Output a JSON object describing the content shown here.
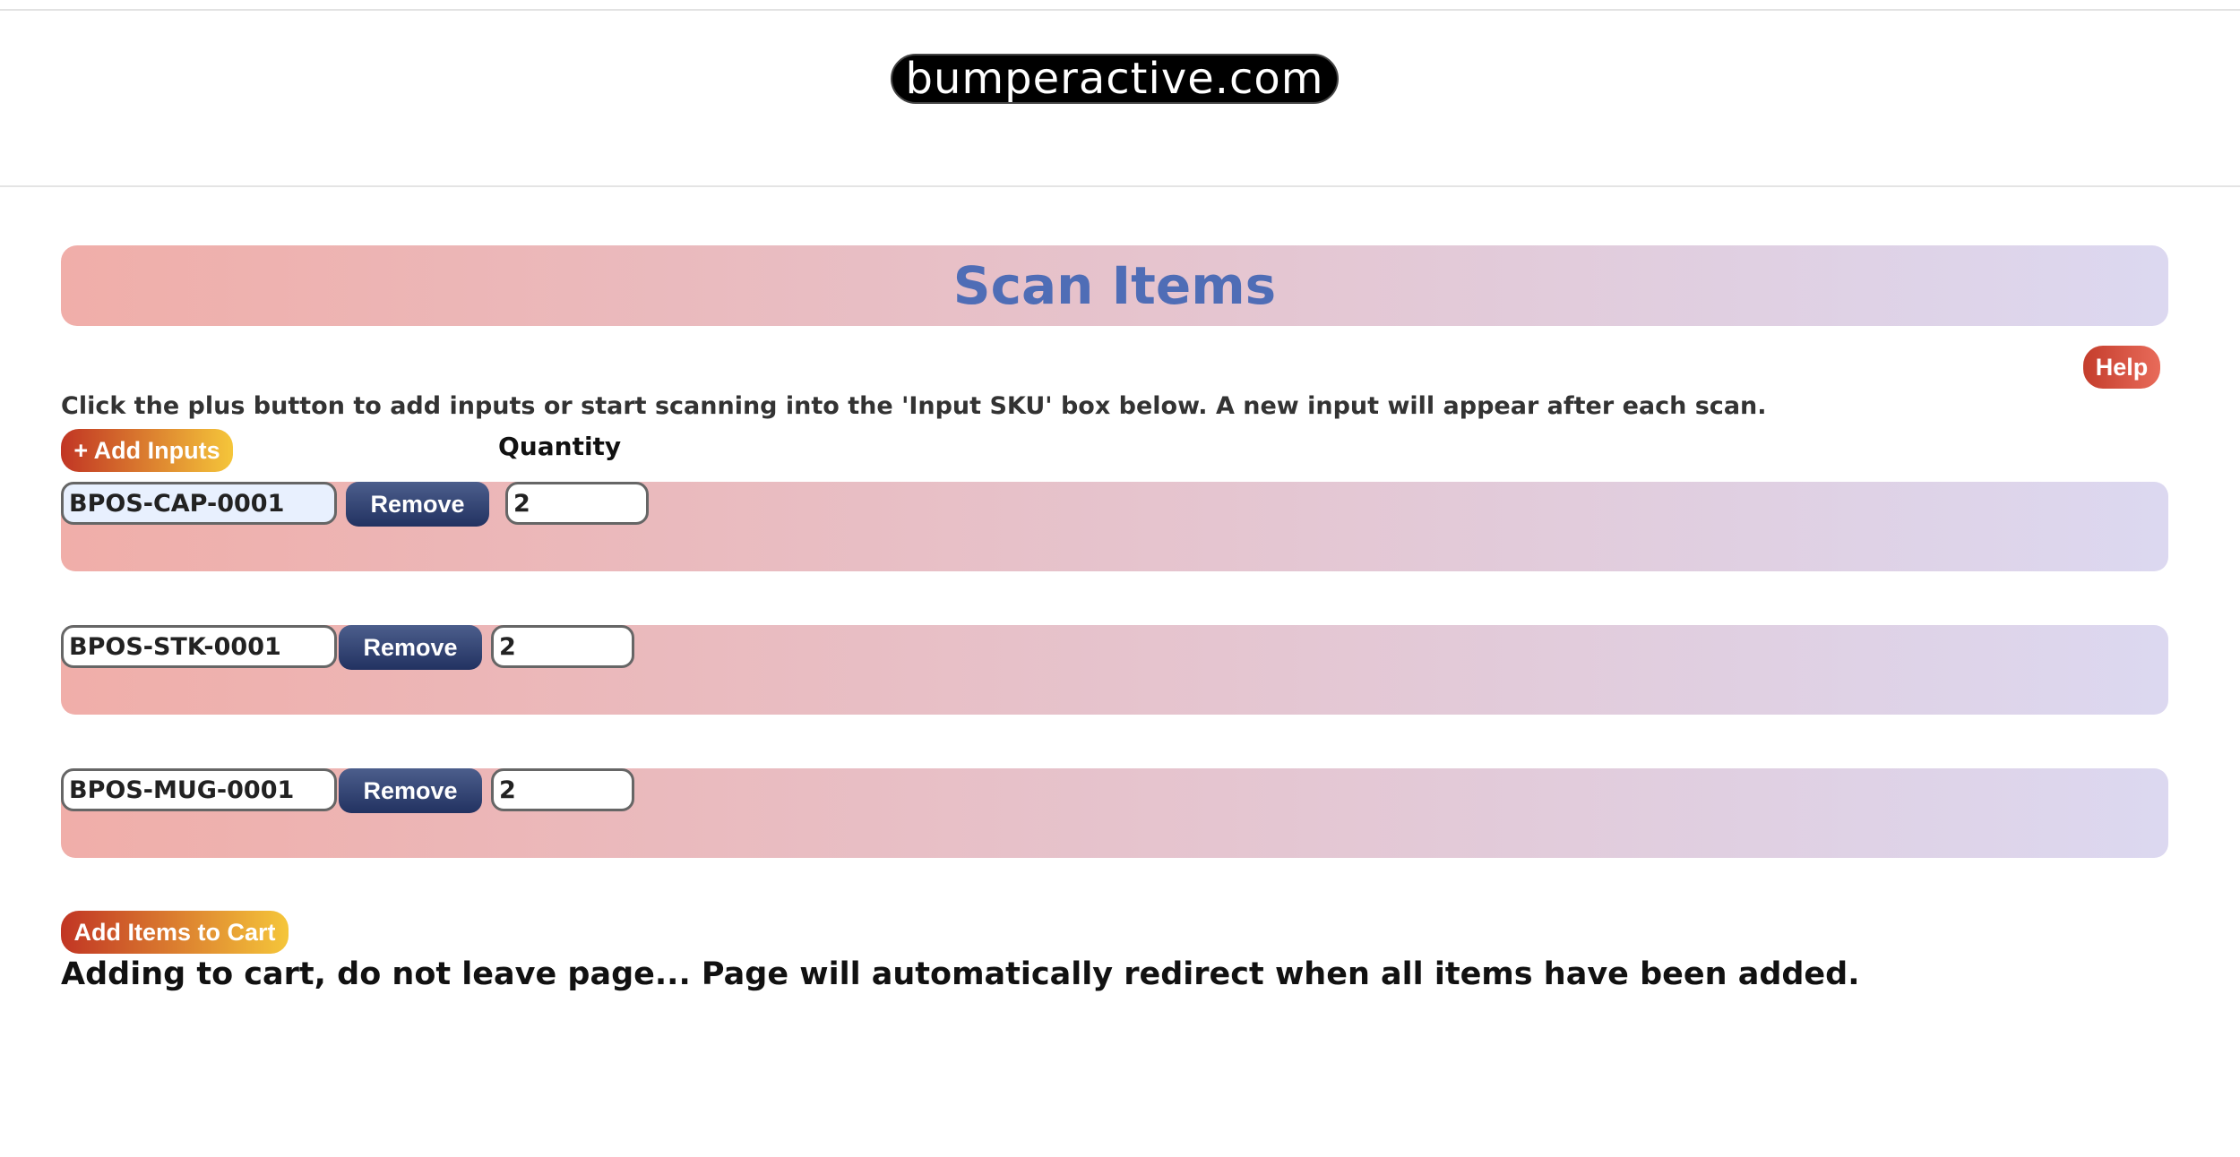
{
  "header": {
    "logo_text": "bumperactive.com"
  },
  "page": {
    "title": "Scan Items",
    "help_label": "Help",
    "instructions": "Click the plus button to add inputs or start scanning into the 'Input SKU' box below. A new input will appear after each scan.",
    "add_inputs_label": "+ Add Inputs",
    "quantity_label": "Quantity"
  },
  "items": [
    {
      "sku": "BPOS-CAP-0001",
      "remove_label": "Remove",
      "quantity": "2"
    },
    {
      "sku": "BPOS-STK-0001",
      "remove_label": "Remove",
      "quantity": "2"
    },
    {
      "sku": "BPOS-MUG-0001",
      "remove_label": "Remove",
      "quantity": "2"
    }
  ],
  "footer": {
    "add_to_cart_label": "Add Items to Cart",
    "status_message": "Adding to cart, do not leave page... Page will automatically redirect when all items have been added."
  },
  "colors": {
    "title_text": "#4f6db6",
    "remove_button": "#223261",
    "banner_start": "#f0aea9",
    "banner_end": "#dcd8f0"
  }
}
